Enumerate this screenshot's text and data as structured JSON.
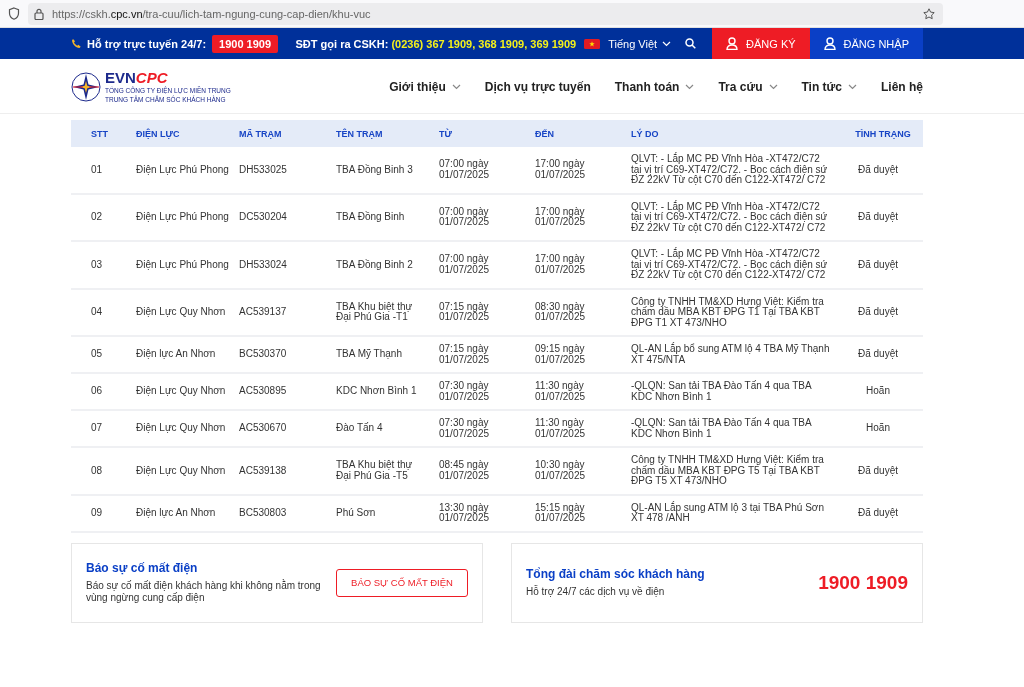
{
  "browser": {
    "url_host": "https://cskh.",
    "url_domain": "cpc.vn",
    "url_path": "/tra-cuu/lich-tam-ngung-cung-cap-dien/khu-vuc"
  },
  "top_bar": {
    "support_label": "Hỗ trợ trực tuyến 24/7:",
    "support_phone": "1900 1909",
    "cskh_label": "SĐT gọi ra CSKH:",
    "cskh_phones": "(0236) 367 1909, 368 1909, 369 1909",
    "language": "Tiếng Việt",
    "register": "ĐĂNG KÝ",
    "login": "ĐĂNG NHẬP"
  },
  "logo": {
    "part1": "EVN",
    "part2": "CPC",
    "line1": "TỔNG CÔNG TY ĐIỆN LỰC MIỀN TRUNG",
    "line2": "TRUNG TÂM CHĂM SÓC KHÁCH HÀNG"
  },
  "nav": [
    {
      "label": "Giới thiệu",
      "has_dropdown": true
    },
    {
      "label": "Dịch vụ trực tuyến",
      "has_dropdown": false
    },
    {
      "label": "Thanh toán",
      "has_dropdown": true
    },
    {
      "label": "Tra cứu",
      "has_dropdown": true
    },
    {
      "label": "Tin tức",
      "has_dropdown": true
    },
    {
      "label": "Liên hệ",
      "has_dropdown": false
    }
  ],
  "table": {
    "columns": [
      "STT",
      "ĐIỆN LỰC",
      "MÃ TRẠM",
      "TÊN TRẠM",
      "TỪ",
      "ĐẾN",
      "LÝ DO",
      "TÌNH TRẠNG"
    ],
    "rows": [
      [
        "01",
        "Điện Lực Phú Phong",
        "DH533025",
        "TBA Đồng Binh 3",
        "07:00 ngày 01/07/2025",
        "17:00 ngày 01/07/2025",
        "QLVT: - Lắp MC PĐ Vĩnh Hòa -XT472/C72 tại vị trí C69-XT472/C72. - Bọc cách điện sứ ĐZ 22kV Từ cột C70 đến C122-XT472/ C72",
        "Đã duyệt"
      ],
      [
        "02",
        "Điện Lực Phú Phong",
        "DC530204",
        "TBA Đồng Binh",
        "07:00 ngày 01/07/2025",
        "17:00 ngày 01/07/2025",
        "QLVT: - Lắp MC PĐ Vĩnh Hòa -XT472/C72 tại vị trí C69-XT472/C72. - Bọc cách điện sứ ĐZ 22kV Từ cột C70 đến C122-XT472/ C72",
        "Đã duyệt"
      ],
      [
        "03",
        "Điện Lực Phú Phong",
        "DH533024",
        "TBA Đồng Binh 2",
        "07:00 ngày 01/07/2025",
        "17:00 ngày 01/07/2025",
        "QLVT: - Lắp MC PĐ Vĩnh Hòa -XT472/C72 tại vị trí C69-XT472/C72. - Bọc cách điện sứ ĐZ 22kV Từ cột C70 đến C122-XT472/ C72",
        "Đã duyệt"
      ],
      [
        "04",
        "Điện Lực Quy Nhơn",
        "AC539137",
        "TBA Khu biệt thự Đại Phú Gia -T1",
        "07:15 ngày 01/07/2025",
        "08:30 ngày 01/07/2025",
        "Công ty TNHH TM&XD Hưng Việt: Kiểm tra chấm dầu MBA KBT ĐPG T1 Tại TBA KBT ĐPG T1 XT 473/NHO",
        "Đã duyệt"
      ],
      [
        "05",
        "Điện lực An Nhơn",
        "BC530370",
        "TBA Mỹ Thạnh",
        "07:15 ngày 01/07/2025",
        "09:15 ngày 01/07/2025",
        "QL-AN Lắp bổ sung ATM lộ 4 TBA Mỹ Thạnh XT 475/NTA",
        "Đã duyệt"
      ],
      [
        "06",
        "Điện Lực Quy Nhơn",
        "AC530895",
        "KDC Nhơn Bình 1",
        "07:30 ngày 01/07/2025",
        "11:30 ngày 01/07/2025",
        "-QLQN: San tải TBA Đào Tấn 4 qua TBA KDC Nhơn Bình 1",
        "Hoãn"
      ],
      [
        "07",
        "Điện Lực Quy Nhơn",
        "AC530670",
        "Đào Tấn 4",
        "07:30 ngày 01/07/2025",
        "11:30 ngày 01/07/2025",
        "-QLQN: San tải TBA Đào Tấn 4 qua TBA KDC Nhơn Bình 1",
        "Hoãn"
      ],
      [
        "08",
        "Điện Lực Quy Nhơn",
        "AC539138",
        "TBA Khu biệt thự Đại Phú Gia -T5",
        "08:45 ngày 01/07/2025",
        "10:30 ngày 01/07/2025",
        "Công ty TNHH TM&XD Hưng Việt: Kiểm tra chấm dầu MBA KBT ĐPG T5 Tại TBA KBT ĐPG T5 XT 473/NHO",
        "Đã duyệt"
      ],
      [
        "09",
        "Điện lực An Nhơn",
        "BC530803",
        "Phú Sơn",
        "13:30 ngày 01/07/2025",
        "15:15 ngày 01/07/2025",
        "QL-AN Lắp sung ATM lộ 3 tại TBA Phú Sơn XT 478 /ANH",
        "Đã duyệt"
      ]
    ]
  },
  "report_card": {
    "title": "Báo sự cố mất điện",
    "text": "Báo sự cố mất điện khách hàng khi không nằm trong vùng ngừng cung cấp điện",
    "button": "BÁO SỰ CỐ MẤT ĐIỆN"
  },
  "hotline_card": {
    "title": "Tổng đài chăm sóc khách hàng",
    "text": "Hỗ trợ 24/7 các dịch vụ về điện",
    "phone": "1900 1909"
  }
}
